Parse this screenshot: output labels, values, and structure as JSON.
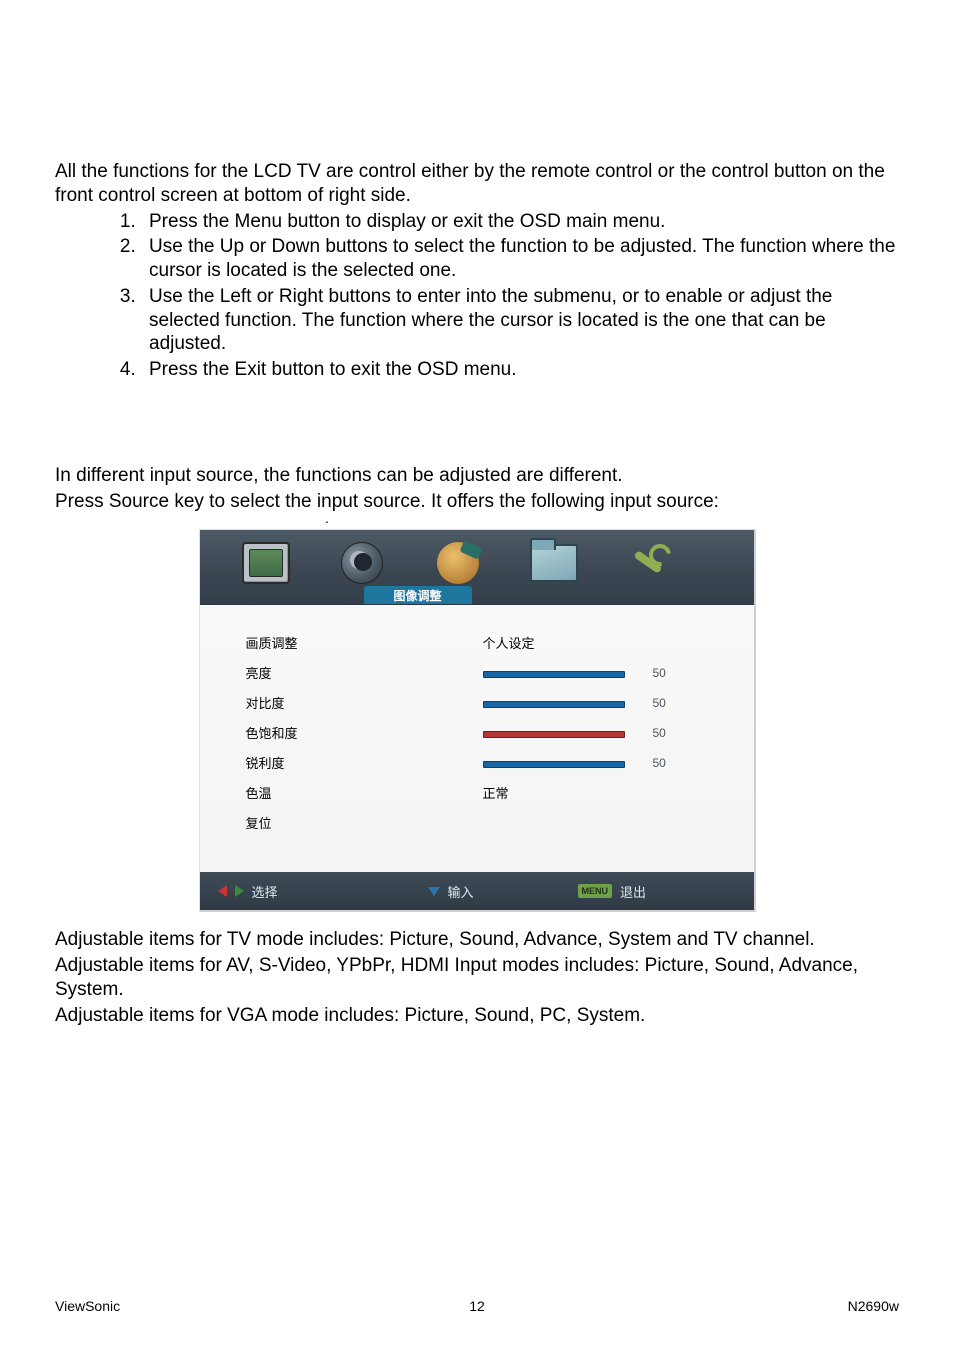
{
  "intro": {
    "line1": "All the functions for the LCD TV are control either by the remote control or the control button on the front control screen at bottom of right side.",
    "li1": "Press the Menu button to display or exit the OSD main menu.",
    "li2": "Use the Up or Down buttons to select the function to be adjusted. The function where the cursor is located is the selected one.",
    "li3": "Use the Left or Right buttons to enter into the submenu, or to enable or adjust the selected function. The function where the cursor is located is the one that can be adjusted.",
    "li4": "Press the Exit button to exit the OSD menu."
  },
  "mid": {
    "line1": "In different input source, the functions can be adjusted are different.",
    "line2": "Press Source key to select the input source. It offers the following input source:"
  },
  "osd": {
    "active_tab_label": "图像调整",
    "labels": {
      "l1": "画质调整",
      "l2": "亮度",
      "l3": "对比度",
      "l4": "色饱和度",
      "l5": "锐利度",
      "l6": "色温",
      "l7": "复位"
    },
    "values": {
      "v1": "个人设定",
      "n2": "50",
      "n3": "50",
      "n4": "50",
      "n5": "50",
      "v6": "正常"
    },
    "footer": {
      "select": "选择",
      "enter": "输入",
      "menu_badge": "MENU",
      "exit": "退出"
    }
  },
  "below": {
    "p1": "Adjustable items for TV mode includes: Picture, Sound, Advance, System and TV channel.",
    "p2": "Adjustable items for AV, S-Video, YPbPr, HDMI Input modes includes: Picture, Sound, Advance, System.",
    "p3": "Adjustable items for VGA mode includes: Picture, Sound, PC, System."
  },
  "footer": {
    "brand": "ViewSonic",
    "page": "12",
    "model": "N2690w"
  }
}
